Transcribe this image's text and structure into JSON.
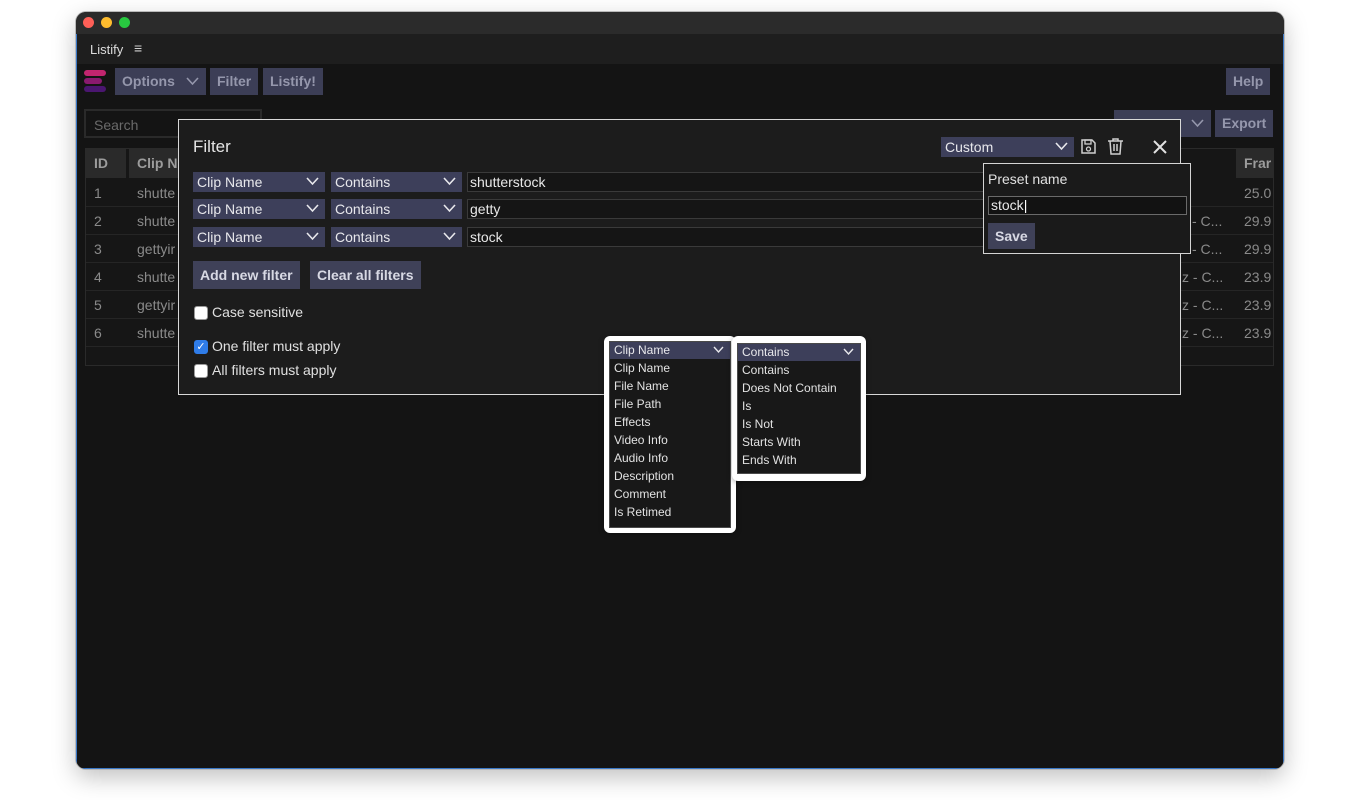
{
  "app": {
    "title": "Listify"
  },
  "toolbar": {
    "options_label": "Options",
    "filter_label": "Filter",
    "listify_label": "Listify!",
    "help_label": "Help",
    "export_label": "Export"
  },
  "search": {
    "placeholder": "Search"
  },
  "table": {
    "columns": [
      "ID",
      "Clip N",
      "Frar"
    ],
    "rows": [
      {
        "id": "1",
        "clip": "shutte",
        "right": "",
        "frame": "25.0"
      },
      {
        "id": "2",
        "clip": "shutte",
        "right": "- C...",
        "frame": "29.9"
      },
      {
        "id": "3",
        "clip": "gettyir",
        "right": "- C...",
        "frame": "29.9"
      },
      {
        "id": "4",
        "clip": "shutte",
        "right": "z - C...",
        "frame": "23.9"
      },
      {
        "id": "5",
        "clip": "gettyir",
        "right": "z - C...",
        "frame": "23.9"
      },
      {
        "id": "6",
        "clip": "shutte",
        "right": "z - C...",
        "frame": "23.9"
      }
    ]
  },
  "dialog": {
    "title": "Filter",
    "preset_select": "Custom",
    "filters": [
      {
        "field": "Clip Name",
        "operator": "Contains",
        "value": "shutterstock"
      },
      {
        "field": "Clip Name",
        "operator": "Contains",
        "value": "getty"
      },
      {
        "field": "Clip Name",
        "operator": "Contains",
        "value": "stock"
      }
    ],
    "add_filter_label": "Add new filter",
    "clear_filters_label": "Clear all filters",
    "case_sensitive_label": "Case sensitive",
    "one_filter_label": "One filter must apply",
    "all_filters_label": "All filters must apply",
    "one_filter_checked": true
  },
  "preset": {
    "label": "Preset name",
    "value": "stock",
    "save_label": "Save"
  },
  "field_dropdown": {
    "selected": "Clip Name",
    "options": [
      "Clip Name",
      "File Name",
      "File Path",
      "Effects",
      "Video Info",
      "Audio Info",
      "Description",
      "Comment",
      "Is Retimed"
    ]
  },
  "operator_dropdown": {
    "selected": "Contains",
    "options": [
      "Contains",
      "Does Not Contain",
      "Is",
      "Is Not",
      "Starts With",
      "Ends With"
    ]
  },
  "colors": {
    "accent": "#3d3f5a",
    "background": "#141414",
    "checkbox": "#2f7ce8"
  }
}
